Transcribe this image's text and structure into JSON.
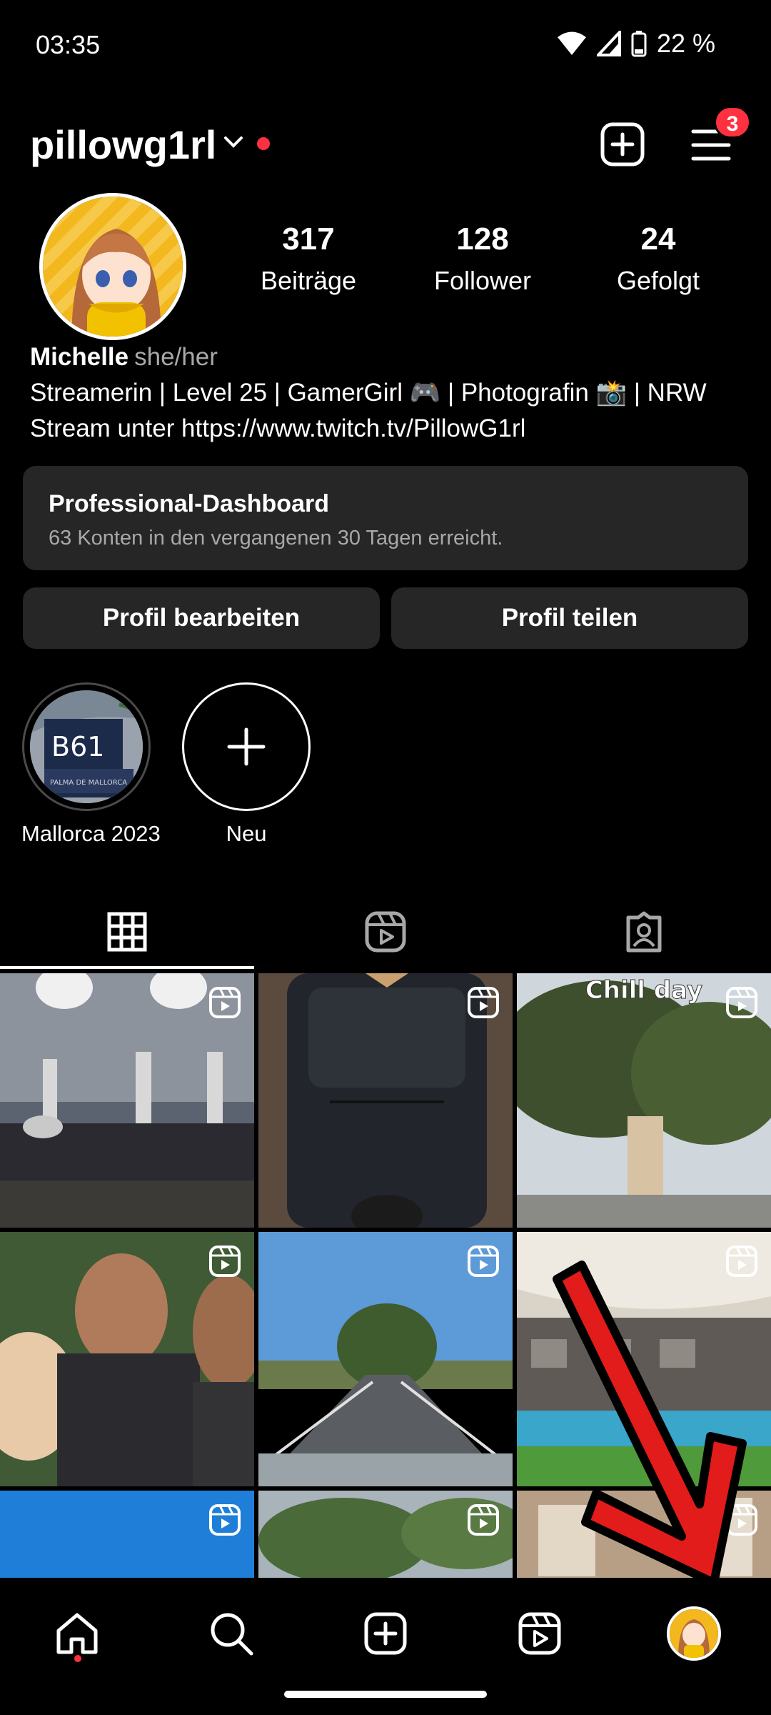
{
  "status_bar": {
    "time": "03:35",
    "battery": "22 %"
  },
  "header": {
    "username": "pillowg1rl",
    "notification_count": "3"
  },
  "profile": {
    "stats": [
      {
        "value": "317",
        "label": "Beiträge"
      },
      {
        "value": "128",
        "label": "Follower"
      },
      {
        "value": "24",
        "label": "Gefolgt"
      }
    ],
    "name": "Michelle",
    "pronouns": "she/her",
    "bio_line1": "Streamerin | Level 25 | GamerGirl 🎮 | Photografin 📸 | NRW",
    "bio_line2": "Stream unter https://www.twitch.tv/PillowG1rl"
  },
  "dashboard": {
    "title": "Professional-Dashboard",
    "subtitle": "63 Konten in den vergangenen 30 Tagen erreicht."
  },
  "buttons": {
    "edit": "Profil bearbeiten",
    "share": "Profil teilen"
  },
  "highlights": [
    {
      "label": "Mallorca 2023",
      "sign_text": "B61",
      "sign_subtext": "PALMA DE MALLORCA"
    },
    {
      "label": "Neu"
    }
  ],
  "tabs": [
    "grid-icon",
    "reels-icon",
    "tagged-icon"
  ],
  "grid_posts": [
    {
      "type": "reel",
      "scene": "concert stage"
    },
    {
      "type": "reel",
      "scene": "backpack"
    },
    {
      "type": "reel",
      "scene": "trees",
      "caption": "Chill day"
    },
    {
      "type": "reel",
      "scene": "selfie group"
    },
    {
      "type": "reel",
      "scene": "road"
    },
    {
      "type": "reel",
      "scene": "hotel pool"
    },
    {
      "type": "reel",
      "scene": "sky"
    },
    {
      "type": "reel",
      "scene": "rocks"
    },
    {
      "type": "reel",
      "scene": "building"
    }
  ],
  "bottom_nav": [
    "home-icon",
    "search-icon",
    "create-icon",
    "reels-icon",
    "profile-avatar"
  ],
  "colors": {
    "background": "#000000",
    "card": "#262626",
    "accent_red": "#ff3040",
    "muted": "#a8a8a8"
  }
}
